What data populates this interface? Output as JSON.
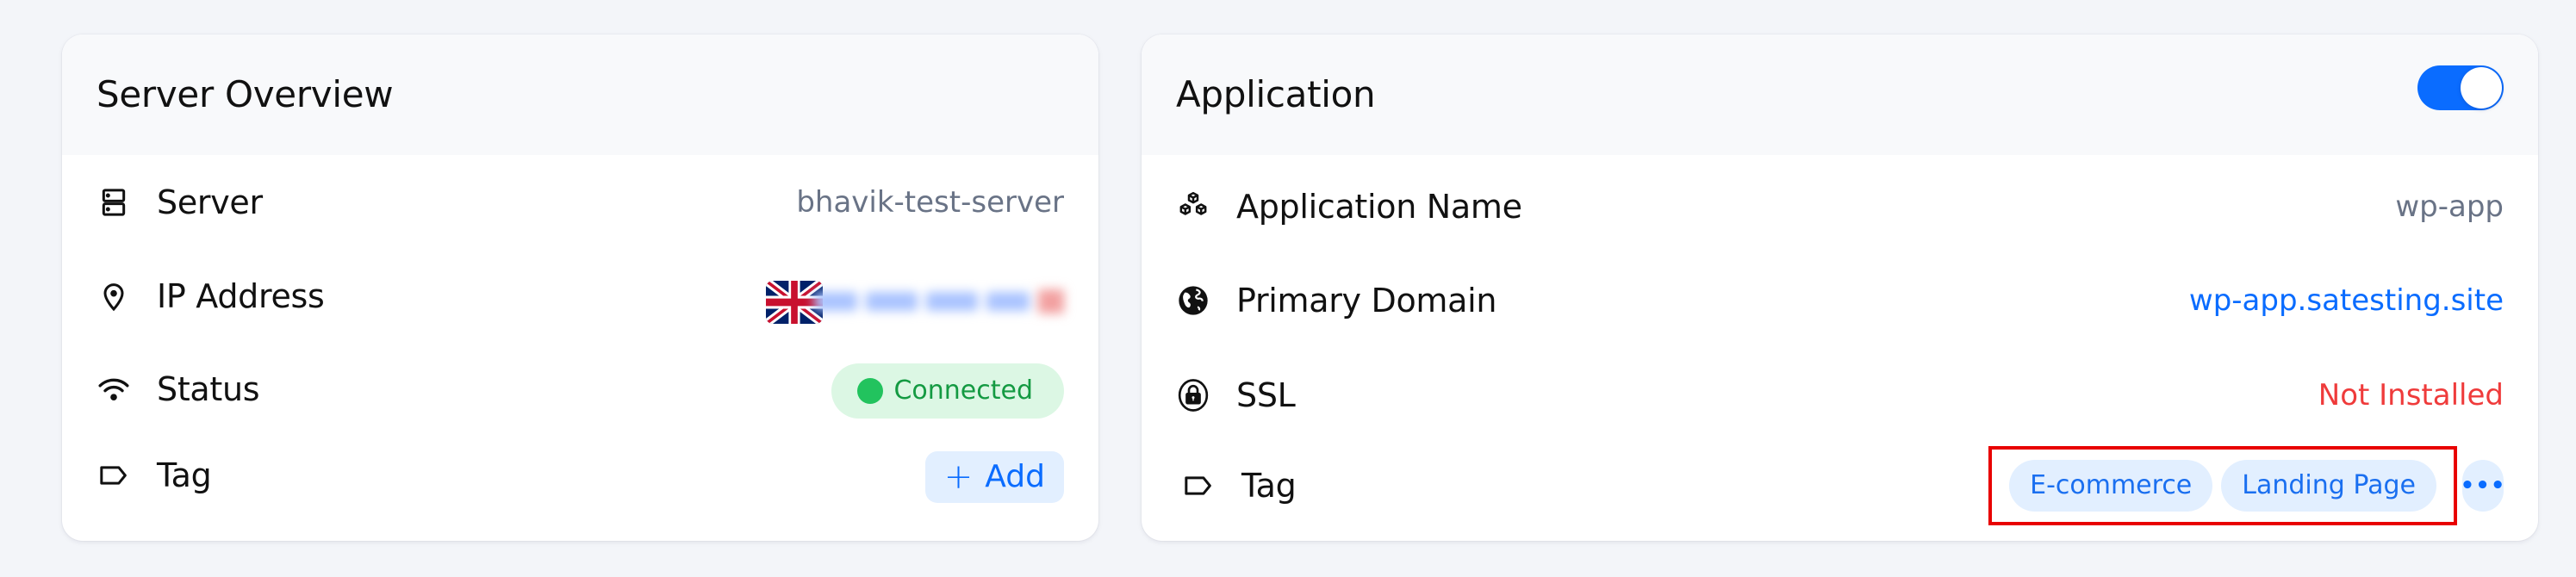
{
  "server_overview": {
    "title": "Server Overview",
    "rows": {
      "server": {
        "icon": "server-icon",
        "label": "Server",
        "value": "bhavik-test-server"
      },
      "ip_address": {
        "icon": "map-pin-icon",
        "label": "IP Address",
        "flag": "uk-flag-icon",
        "value_redacted": true
      },
      "status": {
        "icon": "wifi-icon",
        "label": "Status",
        "value": "Connected",
        "color": "#22c35e"
      },
      "tag": {
        "icon": "tag-icon",
        "label": "Tag",
        "add_label": "Add",
        "add_icon": "plus-icon"
      }
    }
  },
  "application": {
    "title": "Application",
    "toggle_enabled": true,
    "rows": {
      "name": {
        "icon": "cubes-icon",
        "label": "Application Name",
        "value": "wp-app"
      },
      "domain": {
        "icon": "globe-icon",
        "label": "Primary Domain",
        "value": "wp-app.satesting.site"
      },
      "ssl": {
        "icon": "lock-icon",
        "label": "SSL",
        "value": "Not Installed",
        "color": "#ef3b3b"
      },
      "tag": {
        "icon": "tag-icon",
        "label": "Tag",
        "tags": [
          "E-commerce",
          "Landing Page"
        ],
        "more_icon": "more-horizontal-icon",
        "more_label": "•••"
      }
    }
  },
  "colors": {
    "accent": "#0a6cff",
    "success": "#22c35e",
    "danger": "#ef3b3b",
    "highlight": "#e80000"
  }
}
